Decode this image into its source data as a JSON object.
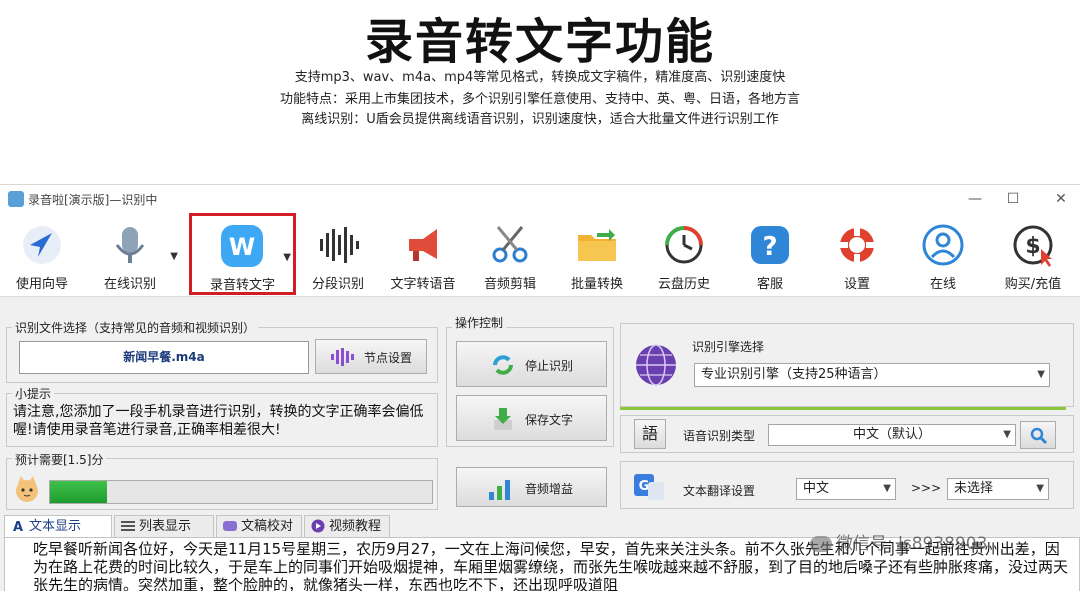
{
  "banner": {
    "headline": "录音转文字功能",
    "line1": "支持mp3、wav、m4a、mp4等常见格式，转换成文字稿件，精准度高、识别速度快",
    "line2": "功能特点：采用上市集团技术，多个识别引擎任意使用、支持中、英、粤、日语，各地方言",
    "line3": "离线识别：U盾会员提供离线语音识别，识别速度快，适合大批量文件进行识别工作"
  },
  "window": {
    "title": "录音啦[演示版]—识别中",
    "min": "—",
    "max": "☐",
    "close": "✕"
  },
  "toolbar": {
    "items": [
      {
        "label": "使用向导",
        "icon": "navigation-arrow-icon"
      },
      {
        "label": "在线识别",
        "icon": "microphone-icon"
      },
      {
        "label": "录音转文字",
        "icon": "w-logo-icon"
      },
      {
        "label": "分段识别",
        "icon": "waveform-icon"
      },
      {
        "label": "文字转语音",
        "icon": "megaphone-icon"
      },
      {
        "label": "音频剪辑",
        "icon": "scissors-icon"
      },
      {
        "label": "批量转换",
        "icon": "folder-icon"
      },
      {
        "label": "云盘历史",
        "icon": "history-clock-icon"
      },
      {
        "label": "客服",
        "icon": "help-icon"
      },
      {
        "label": "设置",
        "icon": "lifebuoy-icon"
      },
      {
        "label": "在线",
        "icon": "user-icon"
      },
      {
        "label": "购买/充值",
        "icon": "purchase-icon"
      }
    ]
  },
  "file_select": {
    "title": "识别文件选择（支持常见的音频和视频识别）",
    "file_name": "新闻早餐.m4a",
    "node_button": "节点设置"
  },
  "tips": {
    "title": "小提示",
    "text": "请注意,您添加了一段手机录音进行识别，转换的文字正确率会偏低喔!请使用录音笔进行录音,正确率相差很大!"
  },
  "estimate": {
    "label": "预计需要[1.5]分",
    "progress": 0.15
  },
  "operations": {
    "title": "操作控制",
    "stop": "停止识别",
    "save": "保存文字",
    "gain": "音频增益"
  },
  "engine": {
    "title": "识别引擎选择",
    "selected": "专业识别引擎（支持25种语言）",
    "lang_icon_text": "語",
    "voice_type_label": "语音识别类型",
    "voice_type_value": "中文（默认）"
  },
  "translate": {
    "label": "文本翻译设置",
    "from": "中文",
    "arrows": ">>>",
    "to": "未选择",
    "icon_text": "G"
  },
  "tabs": [
    {
      "label": "文本显示"
    },
    {
      "label": "列表显示"
    },
    {
      "label": "文稿校对"
    },
    {
      "label": "视频教程"
    }
  ],
  "content_text": "吃早餐听新闻各位好，今天是11月15号星期三，农历9月27，一文在上海问候您，早安，首先来关注头条。前不久张先生和几个同事一起前往贵州出差，因为在路上花费的时间比较久，于是车上的同事们开始吸烟提神，车厢里烟雾缭绕，而张先生喉咙越来越不舒服，到了目的地后嗓子还有些肿胀疼痛，没过两天张先生的病情。突然加重，整个脸肿的，就像猪头一样，东西也吃不下，还出现呼吸道阻",
  "watermark": "微信号: ls8938903",
  "colors": {
    "highlight_border": "#d21d24",
    "progress_green": "#2bb03a",
    "active_tab_text": "#1d3f8a"
  }
}
